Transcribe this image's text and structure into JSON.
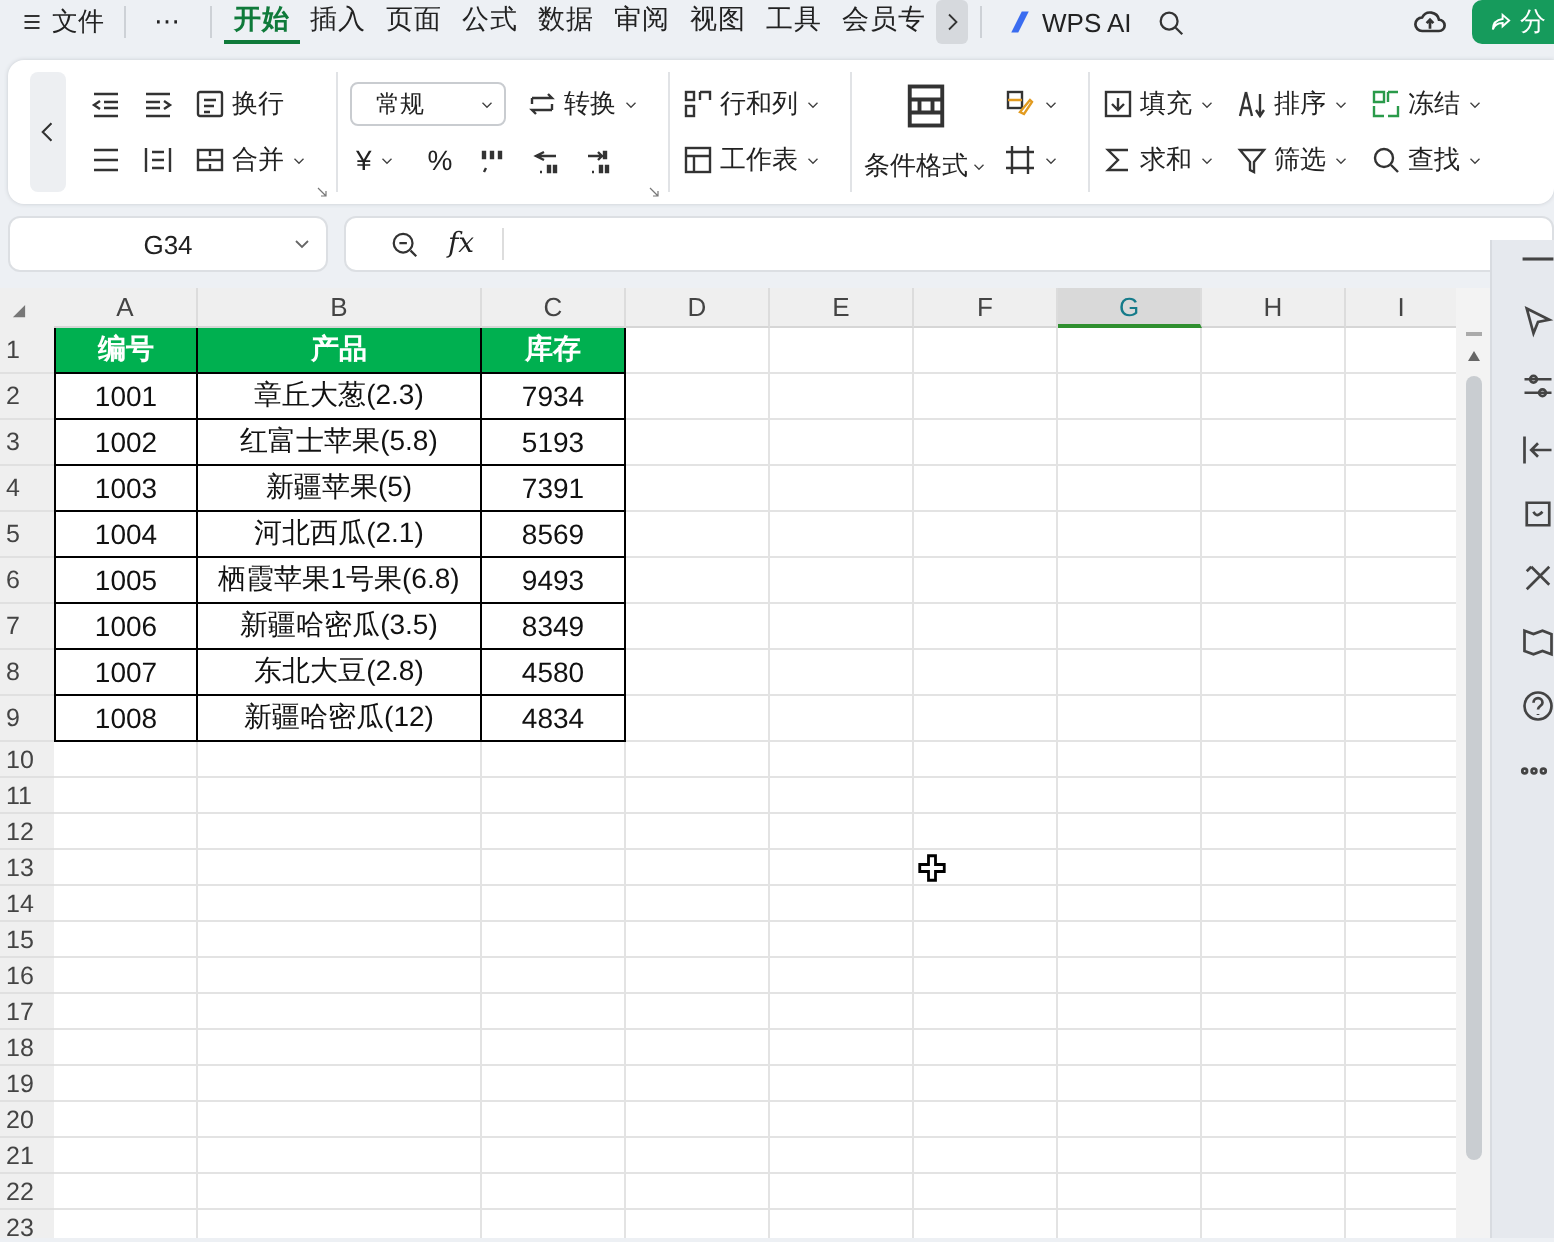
{
  "menu_bar": {
    "file": "文件",
    "more": "⋯",
    "tabs": [
      {
        "label": "开始",
        "selected": true
      },
      {
        "label": "插入",
        "selected": false
      },
      {
        "label": "页面",
        "selected": false
      },
      {
        "label": "公式",
        "selected": false
      },
      {
        "label": "数据",
        "selected": false
      },
      {
        "label": "审阅",
        "selected": false
      },
      {
        "label": "视图",
        "selected": false
      },
      {
        "label": "工具",
        "selected": false
      },
      {
        "label": "会员专",
        "selected": false
      }
    ],
    "ai": "WPS AI",
    "share": "分"
  },
  "ribbon": {
    "groups": [
      {
        "launcher": true,
        "rows": [
          [
            {
              "kind": "icon",
              "dropdown": false
            },
            {
              "kind": "icon",
              "dropdown": false
            },
            {
              "kind": "labeled",
              "label": "换行",
              "dropdown": false
            }
          ],
          [
            {
              "kind": "icon",
              "dropdown": false
            },
            {
              "kind": "icon",
              "dropdown": false
            },
            {
              "kind": "labeled",
              "label": "合并",
              "dropdown": true
            }
          ]
        ]
      },
      {
        "launcher": true,
        "rows": [
          [
            {
              "kind": "select",
              "label": "常规",
              "dropdown": true
            },
            {
              "kind": "labeled",
              "label": "转换",
              "dropdown": true
            }
          ],
          [
            {
              "kind": "glyph",
              "label": "¥",
              "dropdown": true
            },
            {
              "kind": "glyph",
              "label": "%",
              "dropdown": false
            },
            {
              "kind": "icon",
              "dropdown": false
            },
            {
              "kind": "icon",
              "dropdown": false
            },
            {
              "kind": "icon",
              "dropdown": false
            }
          ]
        ]
      },
      {
        "launcher": false,
        "rows": [
          [
            {
              "kind": "labeled",
              "label": "行和列",
              "dropdown": true
            }
          ],
          [
            {
              "kind": "labeled",
              "label": "工作表",
              "dropdown": true
            }
          ]
        ]
      },
      {
        "launcher": false,
        "big": {
          "label": "条件格式",
          "dropdown": true
        },
        "rows": [
          [
            {
              "kind": "icon",
              "dropdown": true
            }
          ],
          [
            {
              "kind": "icon",
              "dropdown": true
            }
          ]
        ]
      },
      {
        "launcher": false,
        "rows": [
          [
            {
              "kind": "labeled",
              "label": "填充",
              "dropdown": true
            },
            {
              "kind": "labeled",
              "label": "排序",
              "dropdown": true
            },
            {
              "kind": "labeled",
              "label": "冻结",
              "dropdown": true
            }
          ],
          [
            {
              "kind": "labeled",
              "label": "求和",
              "dropdown": true
            },
            {
              "kind": "labeled",
              "label": "筛选",
              "dropdown": true
            },
            {
              "kind": "labeled",
              "label": "查找",
              "dropdown": true
            }
          ]
        ]
      }
    ]
  },
  "formula_bar": {
    "name_box": "G34",
    "fx": "fx"
  },
  "sheet": {
    "columns": [
      {
        "label": "A",
        "selected": false
      },
      {
        "label": "B",
        "selected": false
      },
      {
        "label": "C",
        "selected": false
      },
      {
        "label": "D",
        "selected": false
      },
      {
        "label": "E",
        "selected": false
      },
      {
        "label": "F",
        "selected": false
      },
      {
        "label": "G",
        "selected": true
      },
      {
        "label": "H",
        "selected": false
      },
      {
        "label": "I",
        "selected": false
      }
    ],
    "row_numbers": [
      "1",
      "2",
      "3",
      "4",
      "5",
      "6",
      "7",
      "8",
      "9",
      "10",
      "11",
      "12",
      "13",
      "14",
      "15",
      "16",
      "17",
      "18",
      "19",
      "20",
      "21",
      "22",
      "23"
    ],
    "table": {
      "header": [
        "编号",
        "产品",
        "库存"
      ],
      "rows": [
        [
          "1001",
          "章丘大葱(2.3)",
          "7934"
        ],
        [
          "1002",
          "红富士苹果(5.8)",
          "5193"
        ],
        [
          "1003",
          "新疆苹果(5)",
          "7391"
        ],
        [
          "1004",
          "河北西瓜(2.1)",
          "8569"
        ],
        [
          "1005",
          "栖霞苹果1号果(6.8)",
          "9493"
        ],
        [
          "1006",
          "新疆哈密瓜(3.5)",
          "8349"
        ],
        [
          "1007",
          "东北大豆(2.8)",
          "4580"
        ],
        [
          "1008",
          "新疆哈密瓜(12)",
          "4834"
        ]
      ]
    }
  }
}
